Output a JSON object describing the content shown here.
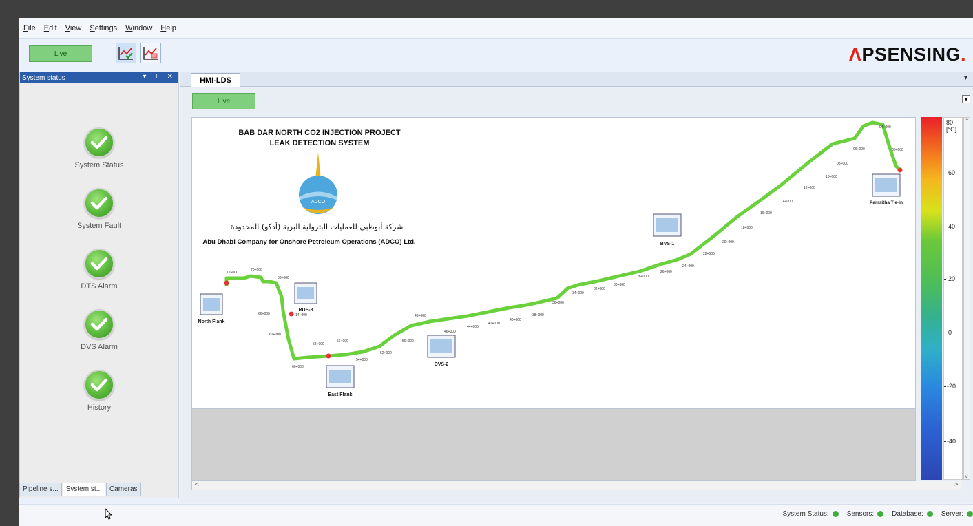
{
  "menu": [
    "File",
    "Edit",
    "View",
    "Settings",
    "Window",
    "Help"
  ],
  "toolbar": {
    "live_label": "Live",
    "button_1_icon": "trend-check-icon",
    "button_2_icon": "trend-alarm-icon"
  },
  "logo": {
    "prefix": "Λ",
    "main": "PSENSING",
    "dot": "."
  },
  "left_panel": {
    "title": "System status",
    "controls": "▾ ⊥ ✕",
    "items": [
      {
        "label": "System Status",
        "icon": "check-circle-icon"
      },
      {
        "label": "System Fault",
        "icon": "check-circle-icon"
      },
      {
        "label": "DTS Alarm",
        "icon": "check-circle-icon"
      },
      {
        "label": "DVS Alarm",
        "icon": "check-circle-icon"
      },
      {
        "label": "History",
        "icon": "check-circle-icon"
      }
    ],
    "tabs": [
      "Pipeline s...",
      "System st...",
      "Cameras"
    ]
  },
  "main": {
    "tab_label": "HMI-LDS",
    "live_label": "Live",
    "hmi": {
      "title_1": "BAB DAR NORTH CO2 INJECTION PROJECT",
      "title_2": "LEAK DETECTION SYSTEM",
      "company_arabic": "شركة أبوظبي للعمليات البترولية البرية (أدكو) المحدودة",
      "company_english": "Abu Dhabi Company for Onshore Petroleum Operations (ADCO) Ltd.",
      "logo_text": "ADCO",
      "stations": [
        "North Flank",
        "RDS-8",
        "East Flank",
        "DVS-2",
        "BVS-1",
        "Pamsitha Tie-in"
      ],
      "chainage_labels": [
        "72+000",
        "70+000",
        "68+000",
        "66+000",
        "62+000",
        "60+000",
        "58+000",
        "56+000",
        "54+000",
        "52+000",
        "50+000",
        "48+000",
        "46+000",
        "44+000",
        "42+000",
        "40+000",
        "38+000",
        "36+000",
        "34+000",
        "32+000",
        "30+000",
        "28+000",
        "26+000",
        "24+000",
        "22+000",
        "20+000",
        "18+000",
        "16+000",
        "14+000",
        "12+000",
        "10+000",
        "08+000",
        "06+000",
        "04+000",
        "00+000",
        "14+000"
      ]
    },
    "scale": {
      "unit": "[°C]",
      "labels": [
        "80",
        "60",
        "40",
        "20",
        "0",
        "-20",
        "-40"
      ]
    }
  },
  "statusbar": {
    "items": [
      {
        "label": "System Status:",
        "color": "#3fae3f"
      },
      {
        "label": "Sensors:",
        "color": "#3fae3f"
      },
      {
        "label": "Database:",
        "color": "#3fae3f"
      },
      {
        "label": "Server:",
        "color": "#3fae3f"
      }
    ]
  },
  "colors": {
    "live_green": "#7fcf7f",
    "pipeline_green": "#6ad13c",
    "status_green": "#3fae3f",
    "header_blue": "#2a5caa",
    "logo_red": "#e2231a"
  }
}
